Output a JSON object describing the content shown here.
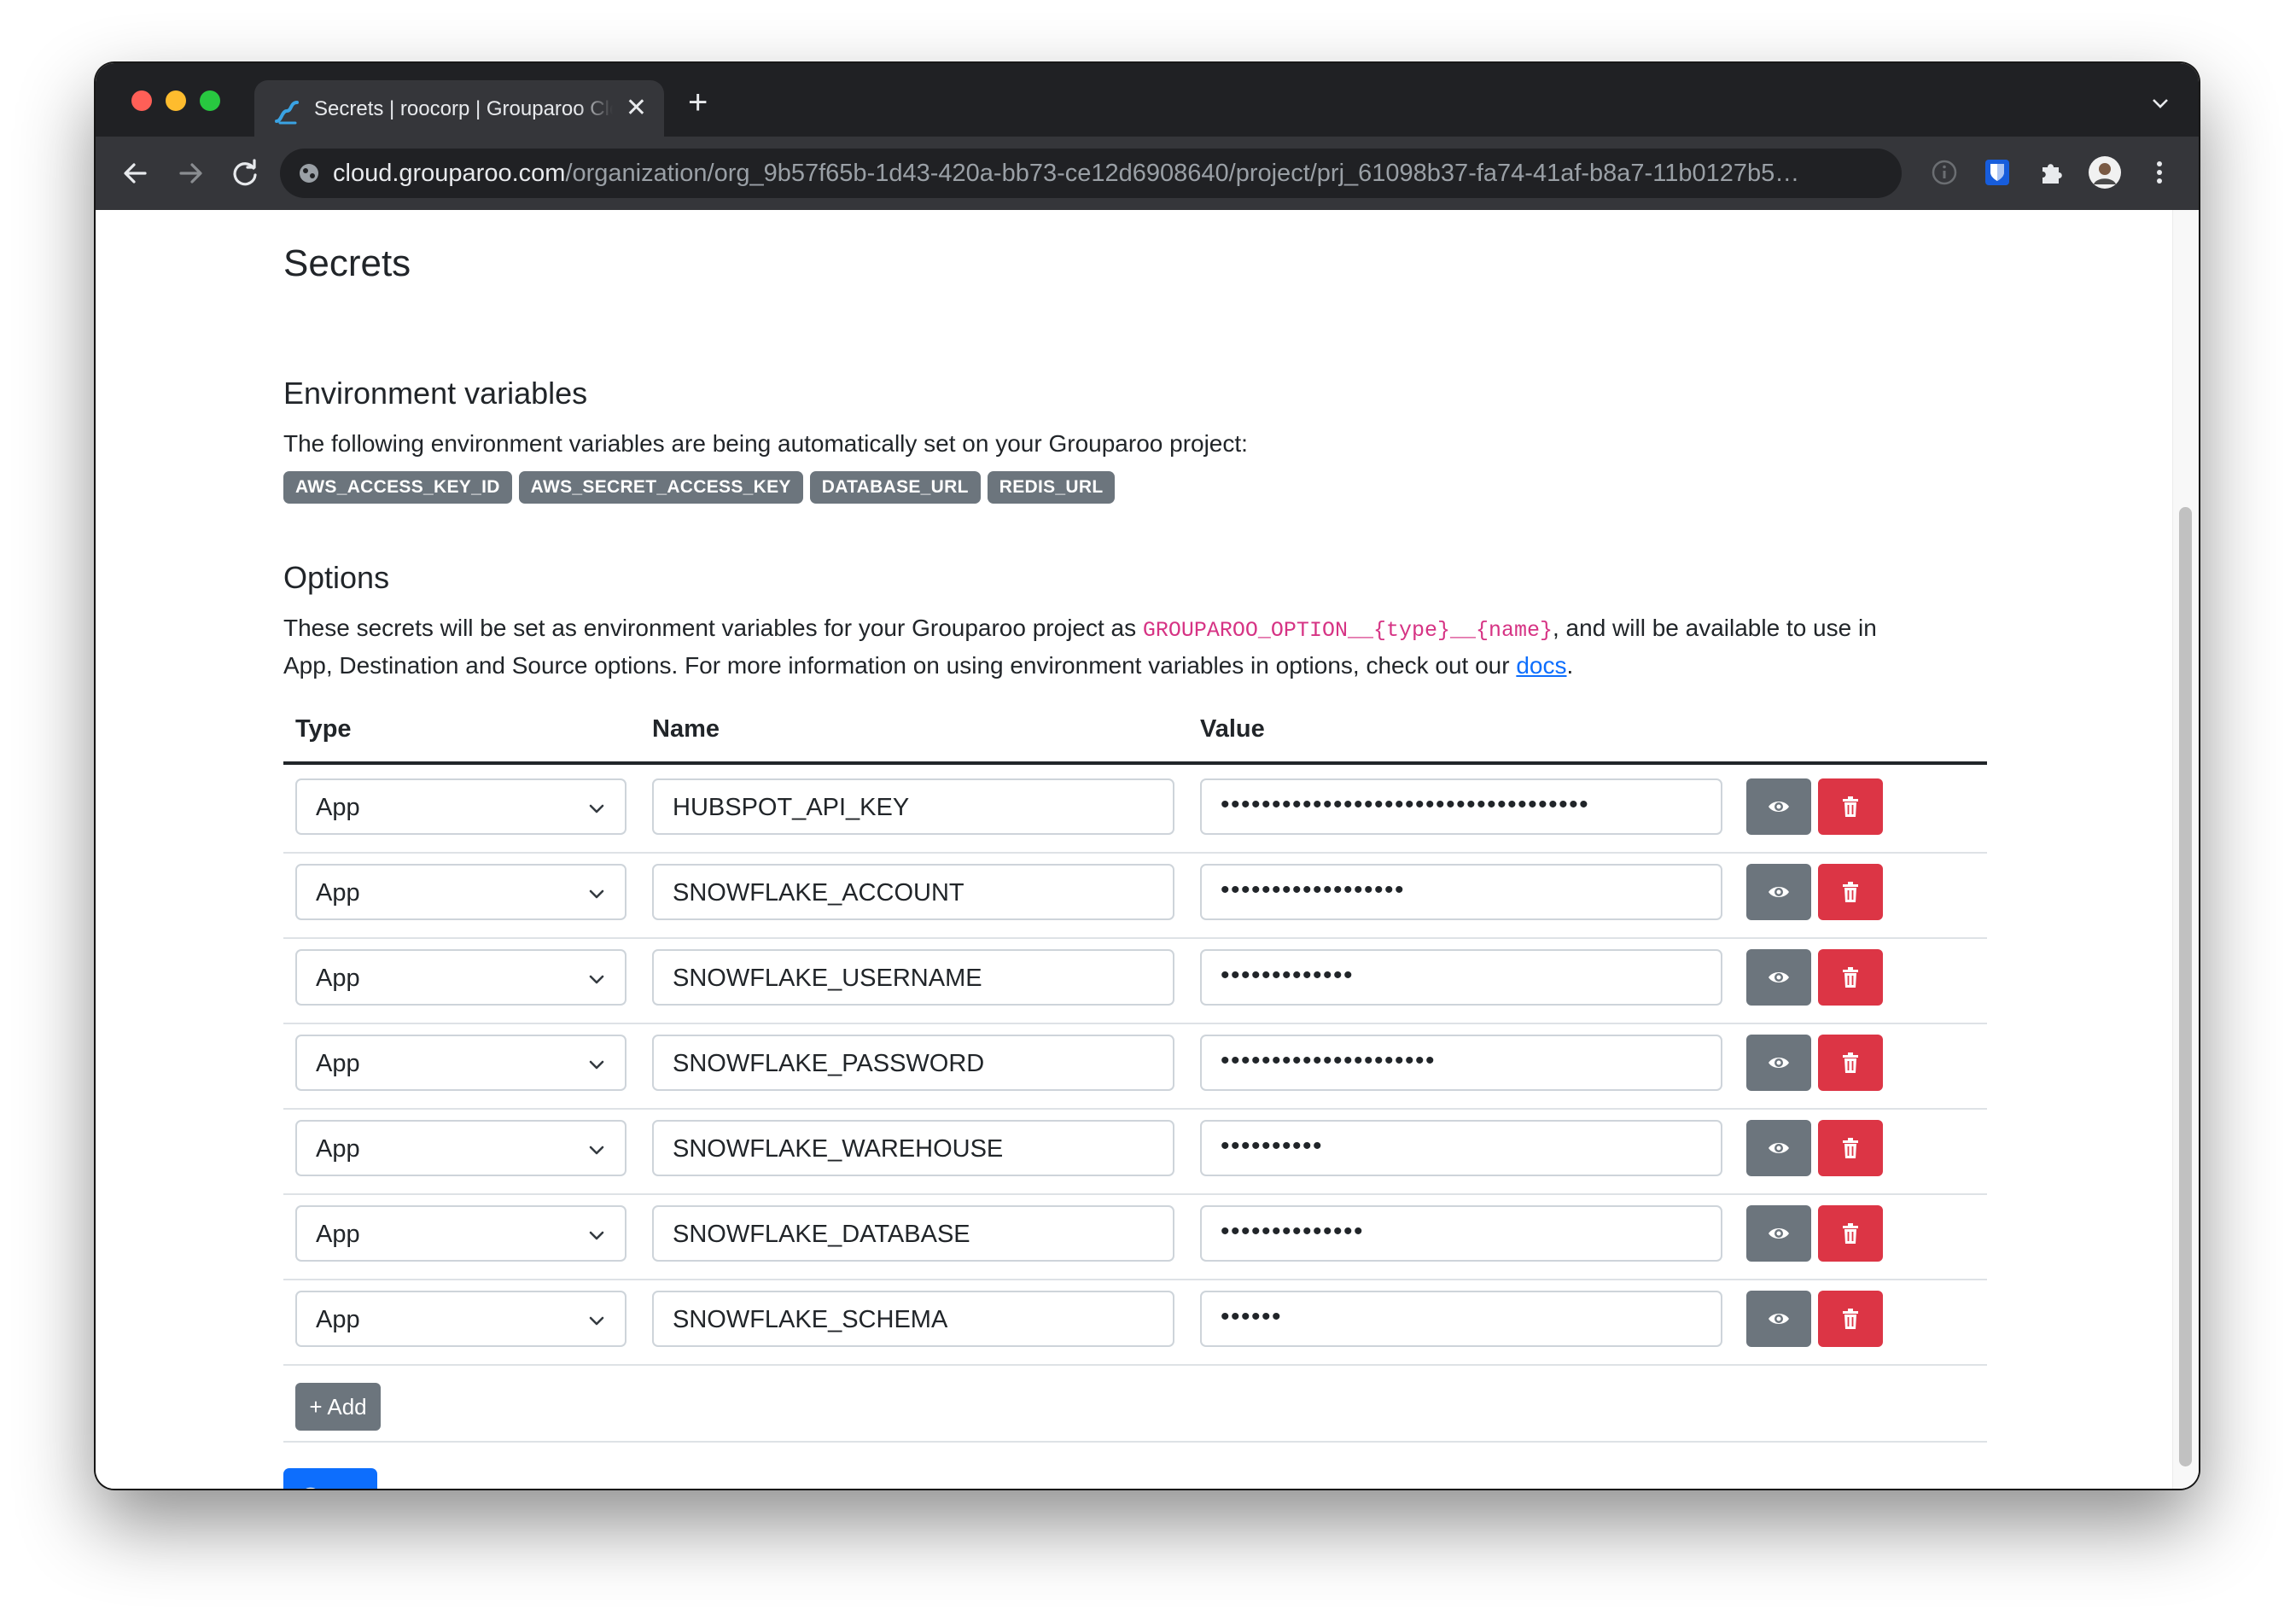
{
  "browser": {
    "tab_title": "Secrets | roocorp | Grouparoo Cloud",
    "url_host": "cloud.grouparoo.com",
    "url_path": "/organization/org_9b57f65b-1d43-420a-bb73-ce12d6908640/project/prj_61098b37-fa74-41af-b8a7-11b0127b5…",
    "icons": [
      "grouparoo-logo-icon",
      "close-icon",
      "plus-icon",
      "chevron-down-icon",
      "back-arrow-icon",
      "forward-arrow-icon",
      "reload-icon",
      "site-info-icon",
      "info-icon",
      "bitwarden-shield-icon",
      "extensions-puzzle-icon",
      "profile-avatar-icon",
      "kebab-menu-icon"
    ]
  },
  "page": {
    "title": "Secrets",
    "env_heading": "Environment variables",
    "env_description": "The following environment variables are being automatically set on your Grouparoo project:",
    "env_badges": [
      "AWS_ACCESS_KEY_ID",
      "AWS_SECRET_ACCESS_KEY",
      "DATABASE_URL",
      "REDIS_URL"
    ],
    "options_heading": "Options",
    "options_text_1": "These secrets will be set as environment variables for your Grouparoo project as ",
    "options_code": "GROUPAROO_OPTION__{type}__{name}",
    "options_text_2": ", and will be available to use in",
    "options_text_3": "App, Destination and Source options. For more information on using environment variables in options, check out our ",
    "docs_link": "docs",
    "options_text_4": "."
  },
  "table": {
    "headers": {
      "type": "Type",
      "name": "Name",
      "value": "Value"
    },
    "rows": [
      {
        "type": "App",
        "name": "HUBSPOT_API_KEY",
        "masked_value": "••••••••••••••••••••••••••••••••••••"
      },
      {
        "type": "App",
        "name": "SNOWFLAKE_ACCOUNT",
        "masked_value": "••••••••••••••••••"
      },
      {
        "type": "App",
        "name": "SNOWFLAKE_USERNAME",
        "masked_value": "•••••••••••••"
      },
      {
        "type": "App",
        "name": "SNOWFLAKE_PASSWORD",
        "masked_value": "•••••••••••••••••••••"
      },
      {
        "type": "App",
        "name": "SNOWFLAKE_WAREHOUSE",
        "masked_value": "••••••••••"
      },
      {
        "type": "App",
        "name": "SNOWFLAKE_DATABASE",
        "masked_value": "••••••••••••••"
      },
      {
        "type": "App",
        "name": "SNOWFLAKE_SCHEMA",
        "masked_value": "••••••"
      }
    ],
    "row_icons": [
      "eye-icon",
      "trash-icon"
    ]
  },
  "actions": {
    "add_label": "+ Add",
    "save_label": "Save"
  },
  "colors": {
    "primary": "#0d6efd",
    "secondary": "#6c757d",
    "danger": "#dc3545",
    "code_pink": "#d63384"
  }
}
